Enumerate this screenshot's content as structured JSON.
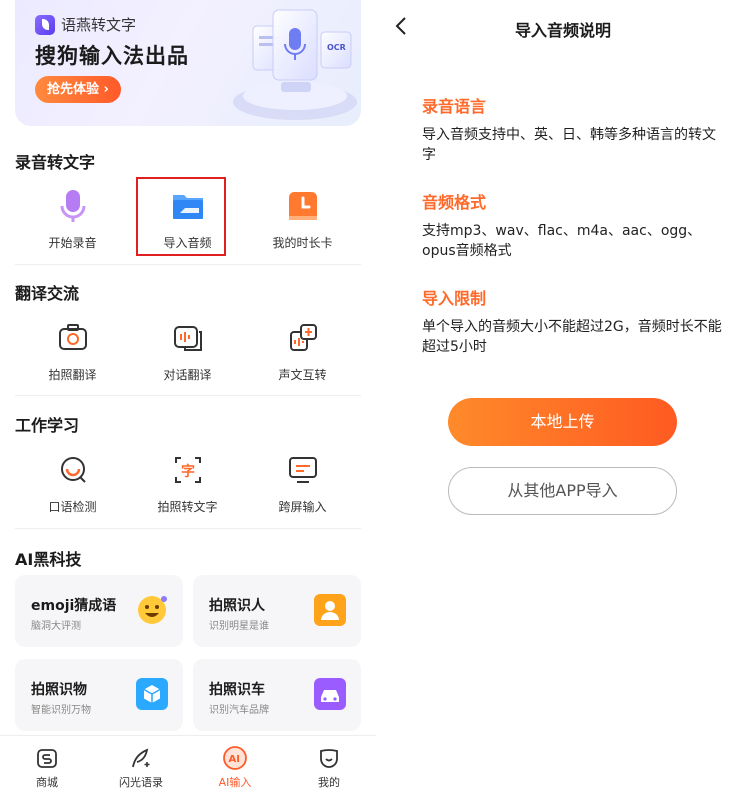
{
  "banner": {
    "brand_name": "语燕转文字",
    "headline": "搜狗输入法出品",
    "cta_label": "抢先体验 ›"
  },
  "sections": {
    "record": {
      "title": "录音转文字",
      "items": [
        {
          "label": "开始录音",
          "icon": "microphone-icon"
        },
        {
          "label": "导入音频",
          "icon": "folder-icon"
        },
        {
          "label": "我的时长卡",
          "icon": "clock-card-icon"
        }
      ]
    },
    "translate": {
      "title": "翻译交流",
      "items": [
        {
          "label": "拍照翻译",
          "icon": "camera-translate-icon"
        },
        {
          "label": "对话翻译",
          "icon": "dialog-translate-icon"
        },
        {
          "label": "声文互转",
          "icon": "voice-text-convert-icon"
        }
      ]
    },
    "work": {
      "title": "工作学习",
      "items": [
        {
          "label": "口语检测",
          "icon": "speech-check-icon"
        },
        {
          "label": "拍照转文字",
          "icon": "photo-to-text-icon"
        },
        {
          "label": "跨屏输入",
          "icon": "cross-screen-icon"
        }
      ]
    },
    "ai": {
      "title": "AI黑科技",
      "cards": [
        {
          "title": "emoji猜成语",
          "subtitle": "脑洞大评测",
          "icon": "emoji-icon"
        },
        {
          "title": "拍照识人",
          "subtitle": "识别明星是谁",
          "icon": "person-recognize-icon"
        },
        {
          "title": "拍照识物",
          "subtitle": "智能识别万物",
          "icon": "object-recognize-icon"
        },
        {
          "title": "拍照识车",
          "subtitle": "识别汽车品牌",
          "icon": "car-recognize-icon"
        }
      ]
    }
  },
  "tabbar": {
    "tabs": [
      {
        "label": "商城",
        "icon": "shop-icon"
      },
      {
        "label": "闪光语录",
        "icon": "quill-icon"
      },
      {
        "label": "AI输入",
        "icon": "ai-icon",
        "active": true
      },
      {
        "label": "我的",
        "icon": "profile-icon"
      }
    ]
  },
  "detail": {
    "title": "导入音频说明",
    "blocks": [
      {
        "heading": "录音语言",
        "text": "导入音频支持中、英、日、韩等多种语言的转文字"
      },
      {
        "heading": "音频格式",
        "text": "支持mp3、wav、flac、m4a、aac、ogg、opus音频格式"
      },
      {
        "heading": "导入限制",
        "text": "单个导入的音频大小不能超过2G，音频时长不能超过5小时"
      }
    ],
    "primary_button": "本地上传",
    "secondary_button": "从其他APP导入"
  },
  "colors": {
    "accent": "#ff6a2a",
    "highlight_border": "#e02020"
  }
}
